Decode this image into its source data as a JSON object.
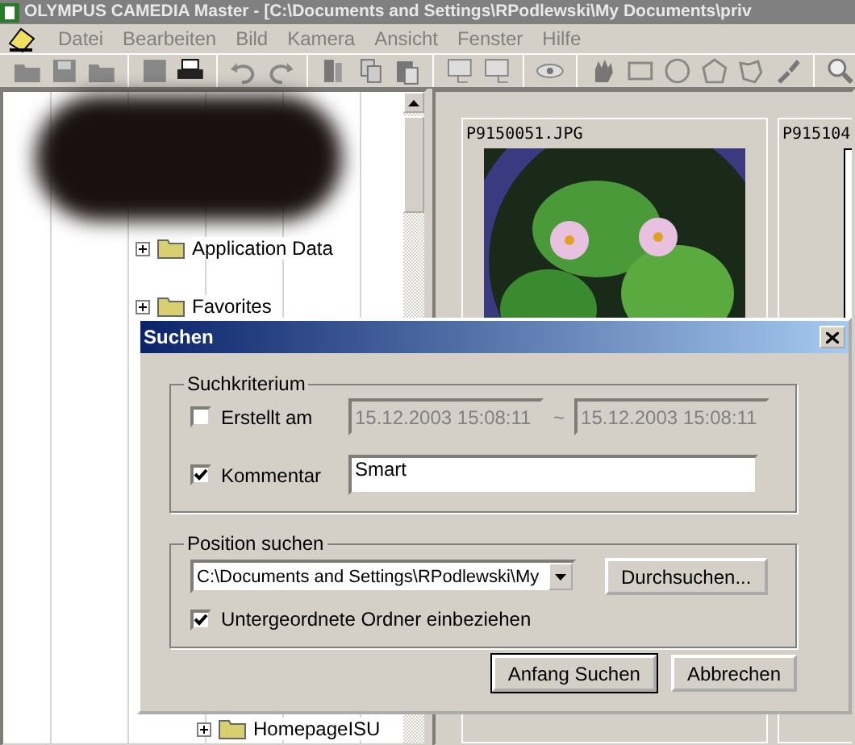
{
  "window": {
    "title": "OLYMPUS CAMEDIA Master - [C:\\Documents and Settings\\RPodlewski\\My Documents\\priv",
    "active": false
  },
  "menu": [
    "Datei",
    "Bearbeiten",
    "Bild",
    "Kamera",
    "Ansicht",
    "Fenster",
    "Hilfe"
  ],
  "tree": {
    "items": [
      {
        "label": "Application Data",
        "expanded": false
      },
      {
        "label": "Favorites",
        "expanded": false
      },
      {
        "label": "HomepageISU",
        "expanded": false
      }
    ]
  },
  "thumbnails": [
    {
      "filename": "P9150051.JPG"
    },
    {
      "filename": "P915104"
    }
  ],
  "dialog": {
    "title": "Suchen",
    "criteria_group": "Suchkriterium",
    "created": {
      "label": "Erstellt am",
      "checked": false,
      "from": "15.12.2003 15:08:11",
      "separator": "~",
      "to": "15.12.2003 15:08:11"
    },
    "comment": {
      "label": "Kommentar",
      "checked": true,
      "value": "Smart"
    },
    "location_group": "Position suchen",
    "path": "C:\\Documents and Settings\\RPodlewski\\My",
    "browse": "Durchsuchen...",
    "subfolders": {
      "label": "Untergeordnete Ordner einbeziehen",
      "checked": true
    },
    "actions": [
      "Anfang Suchen",
      "Abbrechen"
    ]
  }
}
